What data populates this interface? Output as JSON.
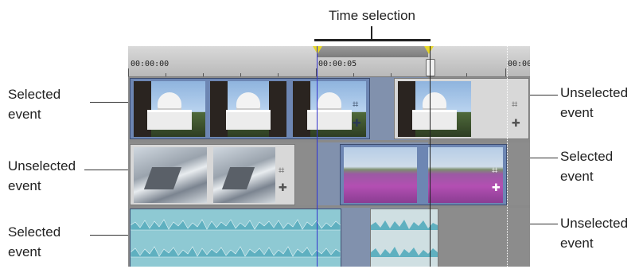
{
  "header": {
    "time_selection_label": "Time selection"
  },
  "ruler": {
    "labels": [
      "00:00:00",
      "00:00:05",
      "00:00"
    ]
  },
  "callouts": {
    "left_1": "Selected\nevent",
    "left_2": "Unselected\nevent",
    "left_3": "Selected\nevent",
    "right_1": "Unselected\nevent",
    "right_2": "Selected\nevent",
    "right_3": "Unselected\nevent"
  },
  "colors": {
    "selected_event_border": "#3d4d70",
    "time_selection_fill": "#7896c8",
    "marker_flag": "#e6d629",
    "audio_wave": "#5fb0c0",
    "audio_bg": "#8ec9d3"
  },
  "icons": [
    "crop-icon",
    "pan-crop-icon",
    "event-fx-icon"
  ]
}
